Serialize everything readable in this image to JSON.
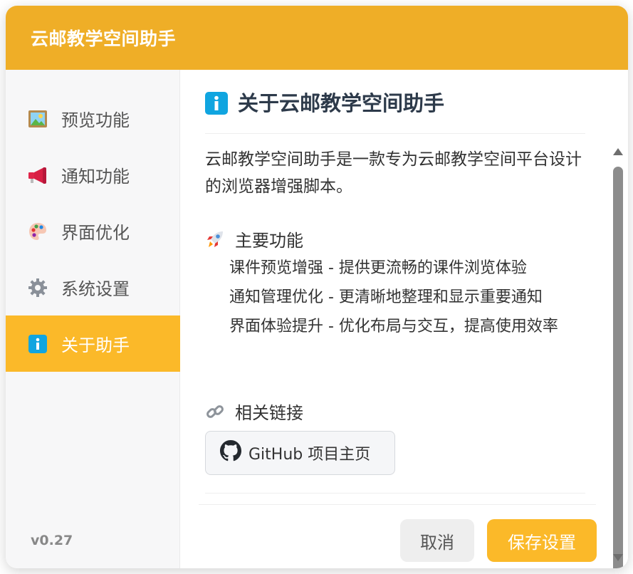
{
  "header": {
    "title": "云邮教学空间助手"
  },
  "sidebar": {
    "items": [
      {
        "label": "预览功能",
        "icon": "picture-icon",
        "active": false
      },
      {
        "label": "通知功能",
        "icon": "megaphone-icon",
        "active": false
      },
      {
        "label": "界面优化",
        "icon": "palette-icon",
        "active": false
      },
      {
        "label": "系统设置",
        "icon": "gear-icon",
        "active": false
      },
      {
        "label": "关于助手",
        "icon": "info-icon",
        "active": true
      }
    ],
    "version": "v0.27"
  },
  "about": {
    "title": "关于云邮教学空间助手",
    "description": "云邮教学空间助手是一款专为云邮教学空间平台设计的浏览器增强脚本。",
    "features_title": "主要功能",
    "features": [
      "课件预览增强 - 提供更流畅的课件浏览体验",
      "通知管理优化 - 更清晰地整理和显示重要通知",
      "界面体验提升 - 优化布局与交互，提高使用效率"
    ],
    "links_title": "相关链接",
    "github_label": "GitHub 项目主页"
  },
  "footer": {
    "cancel_label": "取消",
    "save_label": "保存设置"
  },
  "colors": {
    "header": "#efae27",
    "accent": "#fbb929",
    "info": "#10a5e0"
  }
}
